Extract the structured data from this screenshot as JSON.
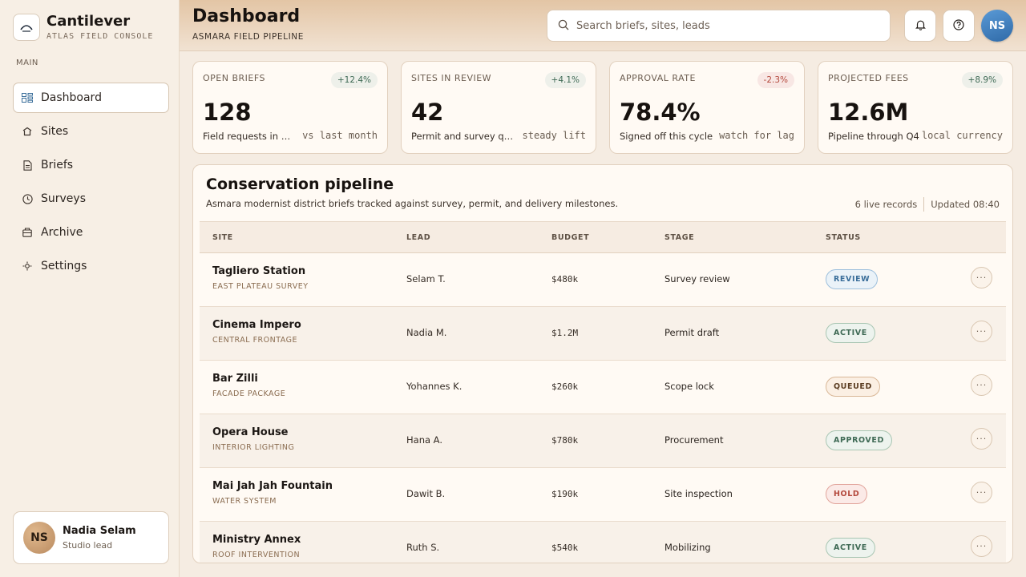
{
  "brand": {
    "name": "Cantilever",
    "subtitle": "ATLAS FIELD CONSOLE",
    "logo_icon": "arch-icon"
  },
  "sidebar": {
    "section_label": "MAIN",
    "items": [
      {
        "label": "Dashboard",
        "icon": "grid-icon",
        "active": true
      },
      {
        "label": "Sites",
        "icon": "building-icon",
        "active": false
      },
      {
        "label": "Briefs",
        "icon": "document-icon",
        "active": false
      },
      {
        "label": "Surveys",
        "icon": "clock-icon",
        "active": false
      },
      {
        "label": "Archive",
        "icon": "archive-icon",
        "active": false
      },
      {
        "label": "Settings",
        "icon": "gear-icon",
        "active": false
      }
    ],
    "user": {
      "initials": "NS",
      "name": "Nadia Selam",
      "role": "Studio lead"
    }
  },
  "header": {
    "title": "Dashboard",
    "subtitle": "ASMARA FIELD PIPELINE",
    "search_placeholder": "Search briefs, sites, leads",
    "avatar_initials": "NS"
  },
  "kpis": [
    {
      "label": "OPEN BRIEFS",
      "delta": "+12.4%",
      "value": "128",
      "desc": "Field requests in motion",
      "note": "vs last month"
    },
    {
      "label": "SITES IN REVIEW",
      "delta": "+4.1%",
      "value": "42",
      "desc": "Permit and survey queue",
      "note": "steady lift"
    },
    {
      "label": "APPROVAL RATE",
      "delta": "-2.3%",
      "value": "78.4%",
      "desc": "Signed off this cycle",
      "note": "watch for lag"
    },
    {
      "label": "PROJECTED FEES",
      "delta": "+8.9%",
      "value": "12.6M",
      "desc": "Pipeline through Q4",
      "note": "local currency"
    }
  ],
  "pipeline": {
    "title": "Conservation pipeline",
    "subtitle": "Asmara modernist district briefs tracked against survey, permit, and delivery milestones.",
    "record_count": "6 live records",
    "updated": "Updated 08:40",
    "columns": {
      "site": "SITE",
      "lead": "LEAD",
      "budget": "BUDGET",
      "stage": "STAGE",
      "status": "STATUS"
    },
    "rows": [
      {
        "site": "Tagliero Station",
        "sub": "EAST PLATEAU SURVEY",
        "lead": "Selam T.",
        "budget": "$480k",
        "stage": "Survey review",
        "status": "REVIEW"
      },
      {
        "site": "Cinema Impero",
        "sub": "CENTRAL FRONTAGE",
        "lead": "Nadia M.",
        "budget": "$1.2M",
        "stage": "Permit draft",
        "status": "ACTIVE"
      },
      {
        "site": "Bar Zilli",
        "sub": "FACADE PACKAGE",
        "lead": "Yohannes K.",
        "budget": "$260k",
        "stage": "Scope lock",
        "status": "QUEUED"
      },
      {
        "site": "Opera House",
        "sub": "INTERIOR LIGHTING",
        "lead": "Hana A.",
        "budget": "$780k",
        "stage": "Procurement",
        "status": "APPROVED"
      },
      {
        "site": "Mai Jah Jah Fountain",
        "sub": "WATER SYSTEM",
        "lead": "Dawit B.",
        "budget": "$190k",
        "stage": "Site inspection",
        "status": "HOLD"
      },
      {
        "site": "Ministry Annex",
        "sub": "ROOF INTERVENTION",
        "lead": "Ruth S.",
        "budget": "$540k",
        "stage": "Mobilizing",
        "status": "ACTIVE"
      }
    ]
  },
  "colors": {
    "accent": "#2f6aa8",
    "positive": "#3f6a55",
    "negative": "#b4493d",
    "background": "#f5ece2"
  }
}
